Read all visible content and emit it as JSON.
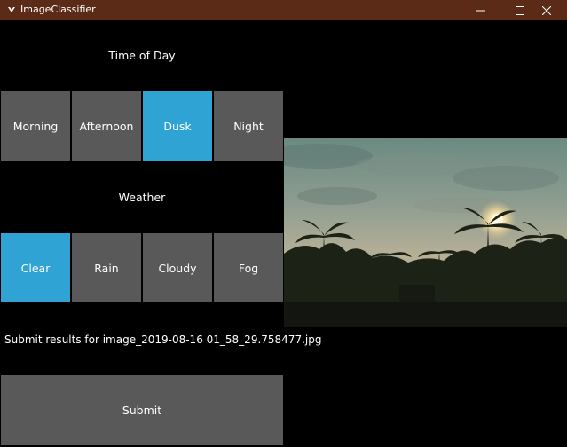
{
  "window": {
    "title": "ImageClassifier",
    "minimize_glyph": "—",
    "maximize_glyph": "☐",
    "close_glyph": "✕"
  },
  "time_of_day": {
    "label": "Time of Day",
    "options": [
      "Morning",
      "Afternoon",
      "Dusk",
      "Night"
    ],
    "selected": "Dusk"
  },
  "weather": {
    "label": "Weather",
    "options": [
      "Clear",
      "Rain",
      "Cloudy",
      "Fog"
    ],
    "selected": "Clear"
  },
  "submit": {
    "info": "Submit results for image_2019-08-16 01_58_29.758477.jpg",
    "button_label": "Submit"
  },
  "image": {
    "description_icon": "dusk-palm-trees-photo"
  },
  "colors": {
    "selected": "#2fa3d3",
    "button": "#595959",
    "titlebar": "#5b2b17",
    "background": "#000000"
  }
}
